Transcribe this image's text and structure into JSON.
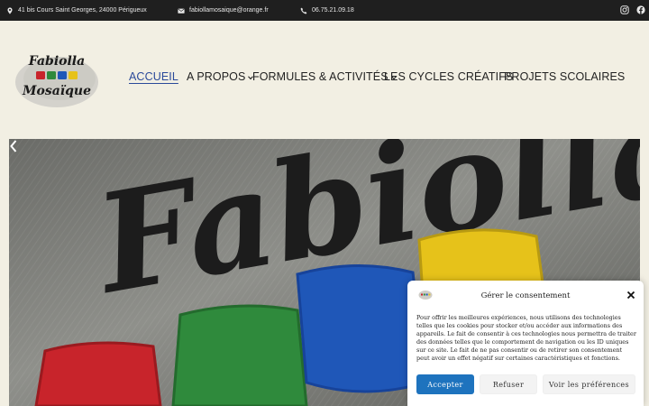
{
  "topbar": {
    "address": "41 bis Cours Saint Georges, 24000 Périgueux",
    "email": "fabiollamosaique@orange.fr",
    "phone": "06.75.21.09.18",
    "social": [
      "instagram-icon",
      "facebook-icon"
    ]
  },
  "logo": {
    "line1": "Fabiolla",
    "line2": "Mosaïque"
  },
  "nav": {
    "items": [
      {
        "label": "ACCUEIL",
        "active": true,
        "has_dropdown": false
      },
      {
        "label": "A PROPOS",
        "active": false,
        "has_dropdown": true
      },
      {
        "label": "FORMULES & ACTIVITÉS",
        "active": false,
        "has_dropdown": true
      },
      {
        "label": "LES CYCLES CRÉATIFS",
        "active": false,
        "has_dropdown": false
      },
      {
        "label": "PROJETS SCOLAIRES",
        "active": false,
        "has_dropdown": false
      }
    ]
  },
  "hero": {
    "embroidered_text": "Fabiolla",
    "tile_colors": [
      "#c8242b",
      "#2f8a3c",
      "#1f57b8",
      "#e6c21a"
    ]
  },
  "consent": {
    "title": "Gérer le consentement",
    "body": "Pour offrir les meilleures expériences, nous utilisons des technologies telles que les cookies pour stocker et/ou accéder aux informations des appareils. Le fait de consentir à ces technologies nous permettra de traiter des données telles que le comportement de navigation ou les ID uniques sur ce site. Le fait de ne pas consentir ou de retirer son consentement peut avoir un effet négatif sur certaines caractéristiques et fonctions.",
    "accept": "Accepter",
    "refuse": "Refuser",
    "preferences": "Voir les préférences",
    "accent": "#1e73be"
  }
}
